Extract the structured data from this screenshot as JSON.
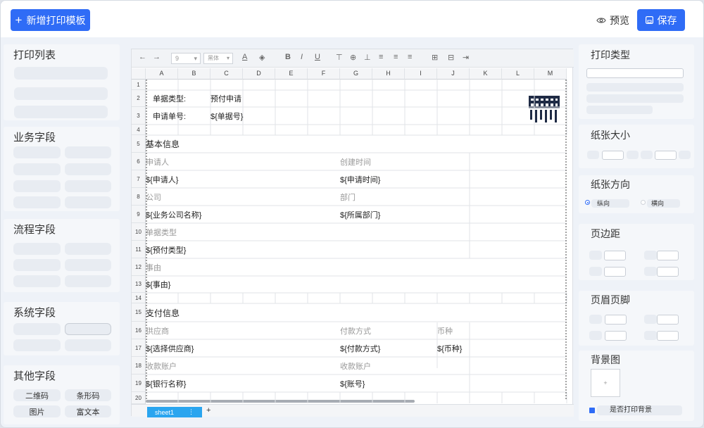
{
  "header": {
    "add_label": "新增打印模板",
    "preview_label": "预览",
    "save_label": "保存"
  },
  "left_panel": {
    "print_list": "打印列表",
    "business_fields": "业务字段",
    "process_fields": "流程字段",
    "system_fields": "系统字段",
    "other_fields": "其他字段",
    "other_items": [
      "二维码",
      "条形码",
      "图片",
      "富文本"
    ]
  },
  "toolbar": {
    "font_size": "9",
    "font_name": "黑体"
  },
  "sheet": {
    "columns": [
      "A",
      "B",
      "C",
      "D",
      "E",
      "F",
      "G",
      "H",
      "I",
      "J",
      "K",
      "L",
      "M"
    ],
    "rows": [
      "1",
      "2",
      "3",
      "4",
      "5",
      "6",
      "7",
      "8",
      "9",
      "10",
      "11",
      "12",
      "13",
      "14",
      "15",
      "16",
      "17",
      "18",
      "19",
      "20"
    ],
    "cells": {
      "r2_label": "单据类型:",
      "r2_value": "预付申请",
      "r3_label": "申请单号:",
      "r3_value": "${单据号}",
      "r5": "基本信息",
      "r6_a": "申请人",
      "r6_g": "创建时间",
      "r7_a": "${申请人}",
      "r7_g": "${申请时间}",
      "r8_a": "公司",
      "r8_g": "部门",
      "r9_a": "${业务公司名称}",
      "r9_g": "${所属部门}",
      "r10": "单据类型",
      "r11": "${预付类型}",
      "r12": "事由",
      "r13": "${事由}",
      "r15": "支付信息",
      "r16_a": "供应商",
      "r16_g": "付款方式",
      "r16_j": "币种",
      "r17_a": "${选择供应商}",
      "r17_g": "${付款方式}",
      "r17_j": "${币种}",
      "r18_a": "收款账户",
      "r18_g": "收款账户",
      "r19_a": "${银行名称}",
      "r19_g": "${账号}"
    },
    "sheet_tab": "sheet1",
    "add_sheet": "+"
  },
  "right_panel": {
    "print_type": "打印类型",
    "paper_size": "纸张大小",
    "paper_orientation": "纸张方向",
    "portrait": "纵向",
    "landscape": "横向",
    "margins": "页边距",
    "header_footer": "页眉页脚",
    "background": "背景图",
    "print_background": "是否打印背景"
  },
  "colors": {
    "primary": "#2f6cf6",
    "sheet_tab": "#2aa5ef",
    "panel_bg": "#f5f7fa"
  }
}
